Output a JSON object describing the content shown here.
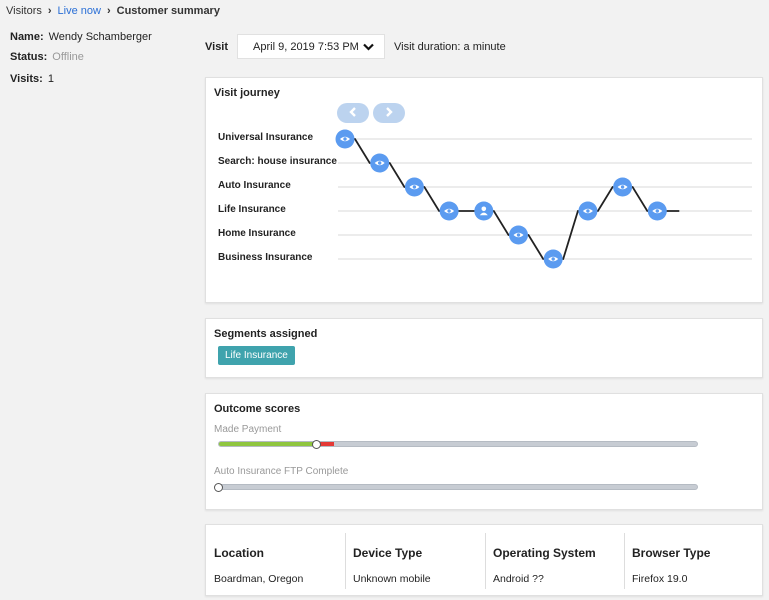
{
  "breadcrumb": {
    "items": [
      "Visitors",
      "Live now",
      "Customer summary"
    ]
  },
  "visitor": {
    "name_label": "Name:",
    "name": "Wendy Schamberger",
    "status_label": "Status:",
    "status": "Offline",
    "visits_label": "Visits:",
    "visits": "1"
  },
  "visit": {
    "label": "Visit",
    "selected": "April 9, 2019 7:53 PM",
    "duration": "Visit duration: a minute"
  },
  "journey": {
    "title": "Visit journey",
    "rows": [
      "Universal Insurance",
      "Search: house insurance",
      "Auto Insurance",
      "Life Insurance",
      "Home Insurance",
      "Business Insurance"
    ],
    "events": [
      {
        "row": 0,
        "icon": "eye-icon"
      },
      {
        "row": 1,
        "icon": "eye-icon"
      },
      {
        "row": 2,
        "icon": "eye-icon"
      },
      {
        "row": 3,
        "icon": "eye-icon"
      },
      {
        "row": 3,
        "icon": "person-icon"
      },
      {
        "row": 4,
        "icon": "eye-icon"
      },
      {
        "row": 5,
        "icon": "eye-icon"
      },
      {
        "row": 3,
        "icon": "eye-icon"
      },
      {
        "row": 2,
        "icon": "eye-icon"
      },
      {
        "row": 3,
        "icon": "eye-icon"
      }
    ],
    "colors": {
      "marker": "#5b9bf0",
      "line": "#222222"
    }
  },
  "segments": {
    "title": "Segments assigned",
    "items": [
      "Life Insurance"
    ],
    "badge_color": "#3fa3ad"
  },
  "outcomes": {
    "title": "Outcome scores",
    "scores": [
      {
        "label": "Made Payment",
        "value": 0.205,
        "red_end": 0.24
      },
      {
        "label": "Auto Insurance FTP Complete",
        "value": 0.0,
        "red_end": 0.0
      }
    ]
  },
  "info": {
    "columns": [
      {
        "heading": "Location",
        "value": "Boardman, Oregon"
      },
      {
        "heading": "Device Type",
        "value": "Unknown mobile"
      },
      {
        "heading": "Operating System",
        "value": "Android ??"
      },
      {
        "heading": "Browser Type",
        "value": "Firefox 19.0"
      }
    ]
  }
}
